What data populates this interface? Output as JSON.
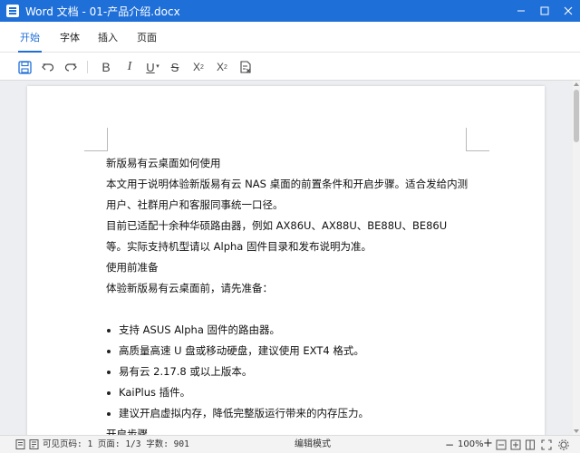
{
  "window": {
    "title": "Word 文档 - 01-产品介绍.docx"
  },
  "tabs": [
    {
      "label": "开始",
      "active": true
    },
    {
      "label": "字体",
      "active": false
    },
    {
      "label": "插入",
      "active": false
    },
    {
      "label": "页面",
      "active": false
    }
  ],
  "toolbar": {
    "bold_label": "B",
    "italic_label": "I",
    "underline_label": "U",
    "strike_label": "S",
    "superscript_label": "X",
    "superscript_mark": "2",
    "subscript_label": "X",
    "subscript_mark": "2"
  },
  "document": {
    "lines": [
      {
        "type": "para",
        "text": "新版易有云桌面如何使用"
      },
      {
        "type": "para",
        "text": "本文用于说明体验新版易有云 NAS 桌面的前置条件和开启步骤。适合发给内测用户、社群用户和客服同事统一口径。"
      },
      {
        "type": "para",
        "text": "目前已适配十余种华硕路由器，例如 AX86U、AX88U、BE88U、BE86U 等。实际支持机型请以 Alpha 固件目录和发布说明为准。"
      },
      {
        "type": "para",
        "text": "使用前准备"
      },
      {
        "type": "para",
        "text": "体验新版易有云桌面前，请先准备："
      },
      {
        "type": "blank",
        "text": ""
      },
      {
        "type": "bullet",
        "text": "支持 ASUS Alpha 固件的路由器。"
      },
      {
        "type": "bullet",
        "text": "高质量高速 U 盘或移动硬盘，建议使用 EXT4 格式。"
      },
      {
        "type": "bullet",
        "text": "易有云 2.17.8 或以上版本。"
      },
      {
        "type": "bullet",
        "text": "KaiPlus 插件。"
      },
      {
        "type": "bullet",
        "text": "建议开启虚拟内存，降低完整版运行带来的内存压力。"
      },
      {
        "type": "para",
        "text": "开启步骤"
      }
    ]
  },
  "status": {
    "page_info": "可见页码: 1 页面: 1/3 字数: 901",
    "mode": "编辑模式",
    "zoom_minus": "−",
    "zoom": "100%",
    "zoom_plus": "+"
  },
  "colors": {
    "accent": "#1f6fd8",
    "titlebar_bg": "#1f6fd8"
  }
}
